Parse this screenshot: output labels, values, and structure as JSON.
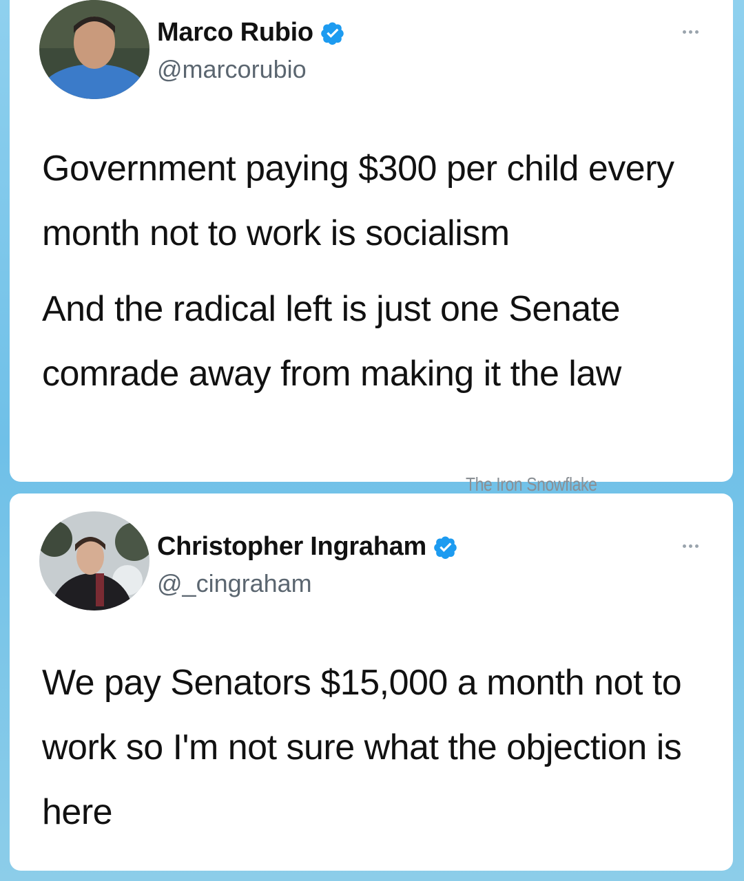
{
  "tweets": [
    {
      "display_name": "Marco Rubio",
      "handle": "@marcorubio",
      "verified": true,
      "paragraphs": [
        "Government paying $300 per child every month not to work is socialism",
        "And the radical left is just one Senate comrade away from making it the law"
      ]
    },
    {
      "display_name": "Christopher Ingraham",
      "handle": "@_cingraham",
      "verified": true,
      "paragraphs": [
        "We pay Senators $15,000 a month not to work so I'm not sure what the objection is here"
      ]
    }
  ],
  "watermark": "The Iron Snowflake",
  "colors": {
    "background": "#7cc6ea",
    "card": "#ffffff",
    "verified": "#1d9bf0",
    "text": "#111111",
    "handle": "#5b6670"
  },
  "icons": {
    "verified": "verified-badge-icon",
    "more": "more-options-icon"
  }
}
